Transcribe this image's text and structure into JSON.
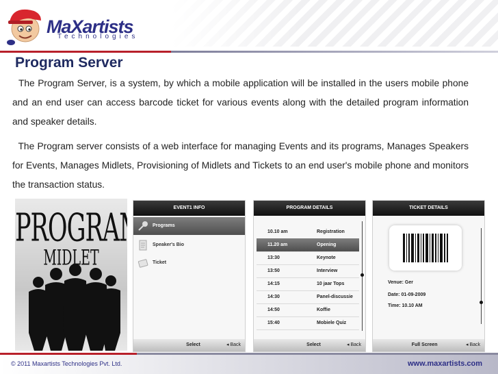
{
  "header": {
    "logo_name": "MaXartists",
    "logo_sub": "Technologies",
    "mascot_icon": "cartoon-mascot-icon"
  },
  "slide": {
    "title": "Program Server",
    "paragraphs": [
      "The Program Server, is a system, by which a mobile application will be installed in the users mobile phone and an end user can access barcode ticket for various events along with the detailed program information and speaker details.",
      "The Program server consists of a web interface for managing Events and its programs, Manages Speakers for Events, Manages Midlets, Provisioning of Midlets and Tickets to an end user's mobile phone and monitors the transaction status."
    ]
  },
  "poster": {
    "line1": "PROGRAM",
    "line2": "MIDLET"
  },
  "screen_event": {
    "title": "EVENT1 INFO",
    "items": [
      {
        "label": "Programs",
        "icon": "microphone-icon",
        "selected": true
      },
      {
        "label": "Speaker's Bio",
        "icon": "document-icon",
        "selected": false
      },
      {
        "label": "Ticket",
        "icon": "ticket-icon",
        "selected": false
      }
    ],
    "softkey_left": "Select",
    "softkey_right": "Back"
  },
  "screen_program": {
    "title": "PROGRAM DETAILS",
    "rows": [
      {
        "time": "10.10 am",
        "event": "Registration",
        "selected": false
      },
      {
        "time": "11.20 am",
        "event": "Opening",
        "selected": true
      },
      {
        "time": "13:30",
        "event": "Keynote",
        "selected": false
      },
      {
        "time": "13:50",
        "event": "Interview",
        "selected": false
      },
      {
        "time": "14:15",
        "event": "10 jaar Tops",
        "selected": false
      },
      {
        "time": "14:30",
        "event": "Panel-discussie",
        "selected": false
      },
      {
        "time": "14:50",
        "event": "Koffie",
        "selected": false
      },
      {
        "time": "15:40",
        "event": "Mobiele Quiz",
        "selected": false
      }
    ],
    "softkey_left": "Select",
    "softkey_right": "Back"
  },
  "screen_ticket": {
    "title": "TICKET DETAILS",
    "venue": "Venue: Ger",
    "date": "Date: 01-09-2009",
    "time": "Time: 10.10 AM",
    "softkey_left": "Full Screen",
    "softkey_right": "Back"
  },
  "footer": {
    "copyright": "© 2011 Maxartists Technologies Pvt. Ltd.",
    "url": "www.maxartists.com"
  },
  "colors": {
    "brand_blue": "#2d2f86",
    "title_navy": "#1f2a60",
    "accent_red": "#b8202a"
  }
}
